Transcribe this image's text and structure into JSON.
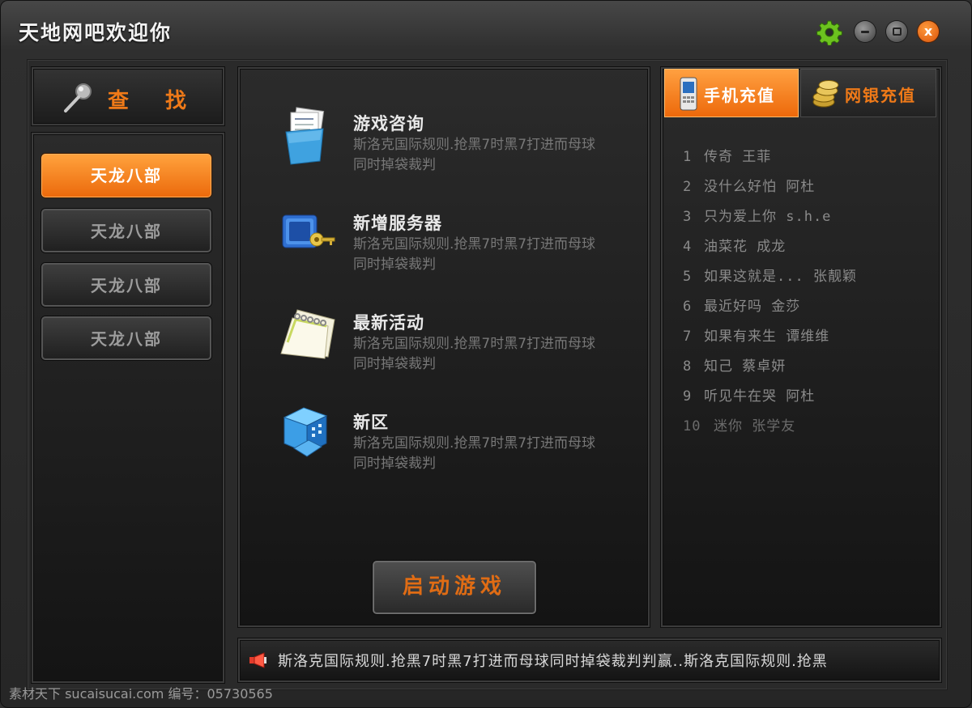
{
  "window": {
    "title": "天地网吧欢迎你"
  },
  "controls": {
    "close_label": "x"
  },
  "search": {
    "label": "查 找"
  },
  "games": [
    {
      "label": "天龙八部",
      "active": true
    },
    {
      "label": "天龙八部",
      "active": false
    },
    {
      "label": "天龙八部",
      "active": false
    },
    {
      "label": "天龙八部",
      "active": false
    }
  ],
  "info_items": [
    {
      "title": "游戏咨询",
      "desc": "斯洛克国际规则.抢黑7时黑7打进而母球同时掉袋裁判",
      "icon": "folder-documents-icon"
    },
    {
      "title": "新增服务器",
      "desc": "斯洛克国际规则.抢黑7时黑7打进而母球同时掉袋裁判",
      "icon": "key-server-icon"
    },
    {
      "title": "最新活动",
      "desc": "斯洛克国际规则.抢黑7时黑7打进而母球同时掉袋裁判",
      "icon": "calendar-icon"
    },
    {
      "title": "新区",
      "desc": "斯洛克国际规则.抢黑7时黑7打进而母球同时掉袋裁判",
      "icon": "building-icon"
    }
  ],
  "start_button": {
    "label": "启动游戏"
  },
  "tabs": {
    "mobile_label": "手机充值",
    "bank_label": "网银充值"
  },
  "songs": [
    {
      "num": "1",
      "title": "传奇  王菲"
    },
    {
      "num": "2",
      "title": "没什么好怕 阿杜"
    },
    {
      "num": "3",
      "title": "只为爱上你 s.h.e"
    },
    {
      "num": "4",
      "title": "油菜花 成龙"
    },
    {
      "num": "5",
      "title": "如果这就是... 张靓颖"
    },
    {
      "num": "6",
      "title": "最近好吗 金莎"
    },
    {
      "num": "7",
      "title": "如果有来生 谭维维"
    },
    {
      "num": "8",
      "title": "知己 蔡卓妍"
    },
    {
      "num": "9",
      "title": "听见牛在哭 阿杜"
    },
    {
      "num": "10",
      "title": "迷你 张学友"
    }
  ],
  "ticker": {
    "text": "斯洛克国际规则.抢黑7时黑7打进而母球同时掉袋裁判判赢..斯洛克国际规则.抢黑"
  },
  "watermark": {
    "text": "素材天下 sucaisucai.com  编号：05730565"
  },
  "colors": {
    "accent": "#f07a18",
    "background": "#2a2a2a",
    "text_muted": "#8a8a8a"
  }
}
